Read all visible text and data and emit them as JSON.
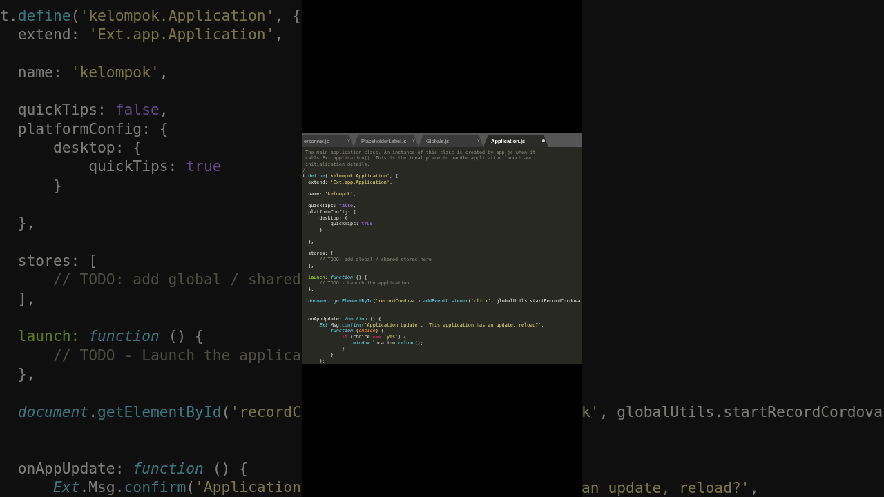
{
  "background": {
    "left_lines": [
      {
        "kind": "code",
        "tokens": [
          {
            "kind": "plain",
            "text": "t."
          },
          {
            "kind": "support",
            "text": "define"
          },
          {
            "kind": "plain",
            "text": "("
          },
          {
            "kind": "string",
            "text": "'kelompok.Application'"
          },
          {
            "kind": "plain",
            "text": ", {"
          }
        ],
        "children": [
          {
            "kind": "code",
            "tokens": [
              {
                "kind": "plain",
                "text": "extend: "
              },
              {
                "kind": "string",
                "text": "'Ext.app.Application'"
              },
              {
                "kind": "plain",
                "text": ","
              }
            ]
          },
          {
            "kind": "blank"
          },
          {
            "kind": "code",
            "tokens": [
              {
                "kind": "plain",
                "text": "name: "
              },
              {
                "kind": "string",
                "text": "'kelompok'"
              },
              {
                "kind": "plain",
                "text": ","
              }
            ]
          },
          {
            "kind": "blank"
          },
          {
            "kind": "code",
            "tokens": [
              {
                "kind": "plain",
                "text": "quickTips: "
              },
              {
                "kind": "constant",
                "text": "false"
              },
              {
                "kind": "plain",
                "text": ","
              }
            ]
          },
          {
            "kind": "code",
            "tokens": [
              {
                "kind": "plain",
                "text": "platformConfig: {"
              }
            ],
            "children": [
              {
                "kind": "code",
                "tokens": [
                  {
                    "kind": "plain",
                    "text": "desktop: {"
                  }
                ],
                "children": [
                  {
                    "kind": "code",
                    "tokens": [
                      {
                        "kind": "plain",
                        "text": "quickTips: "
                      },
                      {
                        "kind": "constant",
                        "text": "true"
                      }
                    ]
                  }
                ]
              },
              {
                "kind": "code",
                "tokens": [
                  {
                    "kind": "plain",
                    "text": "}"
                  }
                ]
              }
            ]
          },
          {
            "kind": "blank"
          },
          {
            "kind": "code",
            "tokens": [
              {
                "kind": "plain",
                "text": "},"
              }
            ]
          },
          {
            "kind": "blank"
          },
          {
            "kind": "code",
            "tokens": [
              {
                "kind": "plain",
                "text": "stores: ["
              }
            ],
            "children": [
              {
                "kind": "code",
                "tokens": [
                  {
                    "kind": "comment",
                    "text": "// TODO: add global / shared"
                  }
                ]
              }
            ]
          },
          {
            "kind": "code",
            "tokens": [
              {
                "kind": "plain",
                "text": "],"
              }
            ]
          },
          {
            "kind": "blank"
          },
          {
            "kind": "code",
            "tokens": [
              {
                "kind": "entity",
                "text": "launch:"
              },
              {
                "kind": "storage",
                "text": " function"
              },
              {
                "kind": "plain",
                "text": " () {"
              }
            ],
            "children": [
              {
                "kind": "code",
                "tokens": [
                  {
                    "kind": "comment",
                    "text": "// TODO - Launch the applica"
                  }
                ]
              }
            ]
          },
          {
            "kind": "code",
            "tokens": [
              {
                "kind": "plain",
                "text": "},"
              }
            ]
          },
          {
            "kind": "blank"
          },
          {
            "kind": "code",
            "tokens": [
              {
                "kind": "object",
                "text": "document"
              },
              {
                "kind": "plain",
                "text": "."
              },
              {
                "kind": "support",
                "text": "getElementById"
              },
              {
                "kind": "plain",
                "text": "("
              },
              {
                "kind": "string",
                "text": "'recordC"
              }
            ]
          },
          {
            "kind": "blank"
          },
          {
            "kind": "blank"
          },
          {
            "kind": "code",
            "tokens": [
              {
                "kind": "plain",
                "text": "onAppUpdate: "
              },
              {
                "kind": "storage",
                "text": "function"
              },
              {
                "kind": "plain",
                "text": " () {"
              }
            ],
            "children": [
              {
                "kind": "code",
                "tokens": [
                  {
                    "kind": "object",
                    "text": "Ext"
                  },
                  {
                    "kind": "plain",
                    "text": ".Msg."
                  },
                  {
                    "kind": "support",
                    "text": "confirm"
                  },
                  {
                    "kind": "plain",
                    "text": "("
                  },
                  {
                    "kind": "string",
                    "text": "'Application"
                  }
                ]
              }
            ]
          }
        ]
      }
    ],
    "right_lines": [
      {
        "kind": "code",
        "tokens": [
          {
            "kind": "string",
            "text": "k'"
          },
          {
            "kind": "plain",
            "text": ", globalUtils.startRecordCordova"
          }
        ]
      },
      {
        "kind": "blank"
      },
      {
        "kind": "blank"
      },
      {
        "kind": "blank"
      },
      {
        "kind": "code",
        "tokens": [
          {
            "kind": "string",
            "text": "an update, reload?'"
          },
          {
            "kind": "plain",
            "text": ","
          }
        ]
      }
    ]
  },
  "editor": {
    "tabs": [
      {
        "label": "ersonnel.js",
        "selected": false,
        "modified": false
      },
      {
        "label": "PlaceholderLabel.js",
        "selected": false,
        "modified": false
      },
      {
        "label": "Globals.js",
        "selected": false,
        "modified": false
      },
      {
        "label": "Application.js",
        "selected": true,
        "modified": true
      }
    ],
    "lines": [
      {
        "kind": "doc",
        "tokens": [
          {
            "kind": "comment",
            "text": "The main application class. An instance of this class is created by app.js when it"
          }
        ]
      },
      {
        "kind": "doc",
        "tokens": [
          {
            "kind": "comment",
            "text": "calls Ext.application(). This is the ideal place to handle application launch and"
          }
        ]
      },
      {
        "kind": "doc",
        "tokens": [
          {
            "kind": "comment",
            "text": "initialization details."
          }
        ]
      },
      {
        "kind": "code",
        "tokens": [
          {
            "kind": "comment",
            "text": "/"
          }
        ]
      },
      {
        "kind": "code",
        "tokens": [
          {
            "kind": "plain",
            "text": "t."
          },
          {
            "kind": "support",
            "text": "define"
          },
          {
            "kind": "plain",
            "text": "("
          },
          {
            "kind": "string",
            "text": "'kelompok.Application'"
          },
          {
            "kind": "plain",
            "text": ", {"
          }
        ],
        "children": [
          {
            "kind": "code",
            "tokens": [
              {
                "kind": "plain",
                "text": "extend: "
              },
              {
                "kind": "string",
                "text": "'Ext.app.Application'"
              },
              {
                "kind": "plain",
                "text": ","
              }
            ]
          },
          {
            "kind": "blank"
          },
          {
            "kind": "code",
            "tokens": [
              {
                "kind": "plain",
                "text": "name: "
              },
              {
                "kind": "string",
                "text": "'kelompok'"
              },
              {
                "kind": "plain",
                "text": ","
              }
            ]
          },
          {
            "kind": "blank"
          },
          {
            "kind": "code",
            "tokens": [
              {
                "kind": "plain",
                "text": "quickTips: "
              },
              {
                "kind": "constant",
                "text": "false"
              },
              {
                "kind": "plain",
                "text": ","
              }
            ]
          },
          {
            "kind": "code",
            "tokens": [
              {
                "kind": "plain",
                "text": "platformConfig: {"
              }
            ],
            "children": [
              {
                "kind": "code",
                "tokens": [
                  {
                    "kind": "plain",
                    "text": "desktop: {"
                  }
                ],
                "children": [
                  {
                    "kind": "code",
                    "tokens": [
                      {
                        "kind": "plain",
                        "text": "quickTips: "
                      },
                      {
                        "kind": "constant",
                        "text": "true"
                      }
                    ]
                  }
                ]
              },
              {
                "kind": "code",
                "tokens": [
                  {
                    "kind": "plain",
                    "text": "}"
                  }
                ]
              }
            ]
          },
          {
            "kind": "blank"
          },
          {
            "kind": "code",
            "tokens": [
              {
                "kind": "plain",
                "text": "},"
              }
            ]
          },
          {
            "kind": "blank"
          },
          {
            "kind": "code",
            "tokens": [
              {
                "kind": "plain",
                "text": "stores: ["
              }
            ],
            "children": [
              {
                "kind": "code",
                "tokens": [
                  {
                    "kind": "comment",
                    "text": "// TODO: add global / shared stores here"
                  }
                ]
              }
            ]
          },
          {
            "kind": "code",
            "tokens": [
              {
                "kind": "plain",
                "text": "],"
              }
            ]
          },
          {
            "kind": "blank"
          },
          {
            "kind": "code",
            "tokens": [
              {
                "kind": "entity",
                "text": "launch:"
              },
              {
                "kind": "storage",
                "text": " function"
              },
              {
                "kind": "plain",
                "text": " () {"
              }
            ],
            "children": [
              {
                "kind": "code",
                "tokens": [
                  {
                    "kind": "comment",
                    "text": "// TODO - Launch the application"
                  }
                ]
              }
            ]
          },
          {
            "kind": "code",
            "tokens": [
              {
                "kind": "plain",
                "text": "},"
              }
            ]
          },
          {
            "kind": "blank"
          },
          {
            "kind": "code",
            "tokens": [
              {
                "kind": "object",
                "text": "document"
              },
              {
                "kind": "plain",
                "text": "."
              },
              {
                "kind": "support",
                "text": "getElementById"
              },
              {
                "kind": "plain",
                "text": "("
              },
              {
                "kind": "string",
                "text": "'recordCordova'"
              },
              {
                "kind": "plain",
                "text": ")."
              },
              {
                "kind": "support",
                "text": "addEventListener"
              },
              {
                "kind": "plain",
                "text": "("
              },
              {
                "kind": "string",
                "text": "'click'"
              },
              {
                "kind": "plain",
                "text": ", globalUtils.startRecordCordova"
              }
            ]
          },
          {
            "kind": "blank"
          },
          {
            "kind": "blank"
          },
          {
            "kind": "code",
            "tokens": [
              {
                "kind": "plain",
                "text": "onAppUpdate: "
              },
              {
                "kind": "storage",
                "text": "function"
              },
              {
                "kind": "plain",
                "text": " () {"
              }
            ],
            "children": [
              {
                "kind": "code",
                "tokens": [
                  {
                    "kind": "object",
                    "text": "Ext"
                  },
                  {
                    "kind": "plain",
                    "text": ".Msg."
                  },
                  {
                    "kind": "support",
                    "text": "confirm"
                  },
                  {
                    "kind": "plain",
                    "text": "("
                  },
                  {
                    "kind": "string",
                    "text": "'Application Update'"
                  },
                  {
                    "kind": "plain",
                    "text": ", "
                  },
                  {
                    "kind": "string",
                    "text": "'This application has an update, reload?'"
                  },
                  {
                    "kind": "plain",
                    "text": ","
                  }
                ],
                "children": [
                  {
                    "kind": "code",
                    "tokens": [
                      {
                        "kind": "storage",
                        "text": "function"
                      },
                      {
                        "kind": "plain",
                        "text": " ("
                      },
                      {
                        "kind": "param",
                        "text": "choice"
                      },
                      {
                        "kind": "plain",
                        "text": ") {"
                      }
                    ],
                    "children": [
                      {
                        "kind": "code",
                        "tokens": [
                          {
                            "kind": "keyword",
                            "text": "if"
                          },
                          {
                            "kind": "plain",
                            "text": " (choice "
                          },
                          {
                            "kind": "keyword",
                            "text": "==="
                          },
                          {
                            "kind": "string",
                            "text": " 'yes'"
                          },
                          {
                            "kind": "plain",
                            "text": ") {"
                          }
                        ],
                        "children": [
                          {
                            "kind": "code",
                            "tokens": [
                              {
                                "kind": "object",
                                "text": "window"
                              },
                              {
                                "kind": "plain",
                                "text": ".location."
                              },
                              {
                                "kind": "support",
                                "text": "reload"
                              },
                              {
                                "kind": "plain",
                                "text": "();"
                              }
                            ]
                          }
                        ]
                      },
                      {
                        "kind": "code",
                        "tokens": [
                          {
                            "kind": "plain",
                            "text": "}"
                          }
                        ]
                      }
                    ]
                  },
                  {
                    "kind": "code",
                    "tokens": [
                      {
                        "kind": "plain",
                        "text": "}"
                      }
                    ]
                  }
                ]
              },
              {
                "kind": "code",
                "tokens": [
                  {
                    "kind": "plain",
                    "text": ");"
                  }
                ]
              }
            ]
          }
        ]
      }
    ]
  }
}
